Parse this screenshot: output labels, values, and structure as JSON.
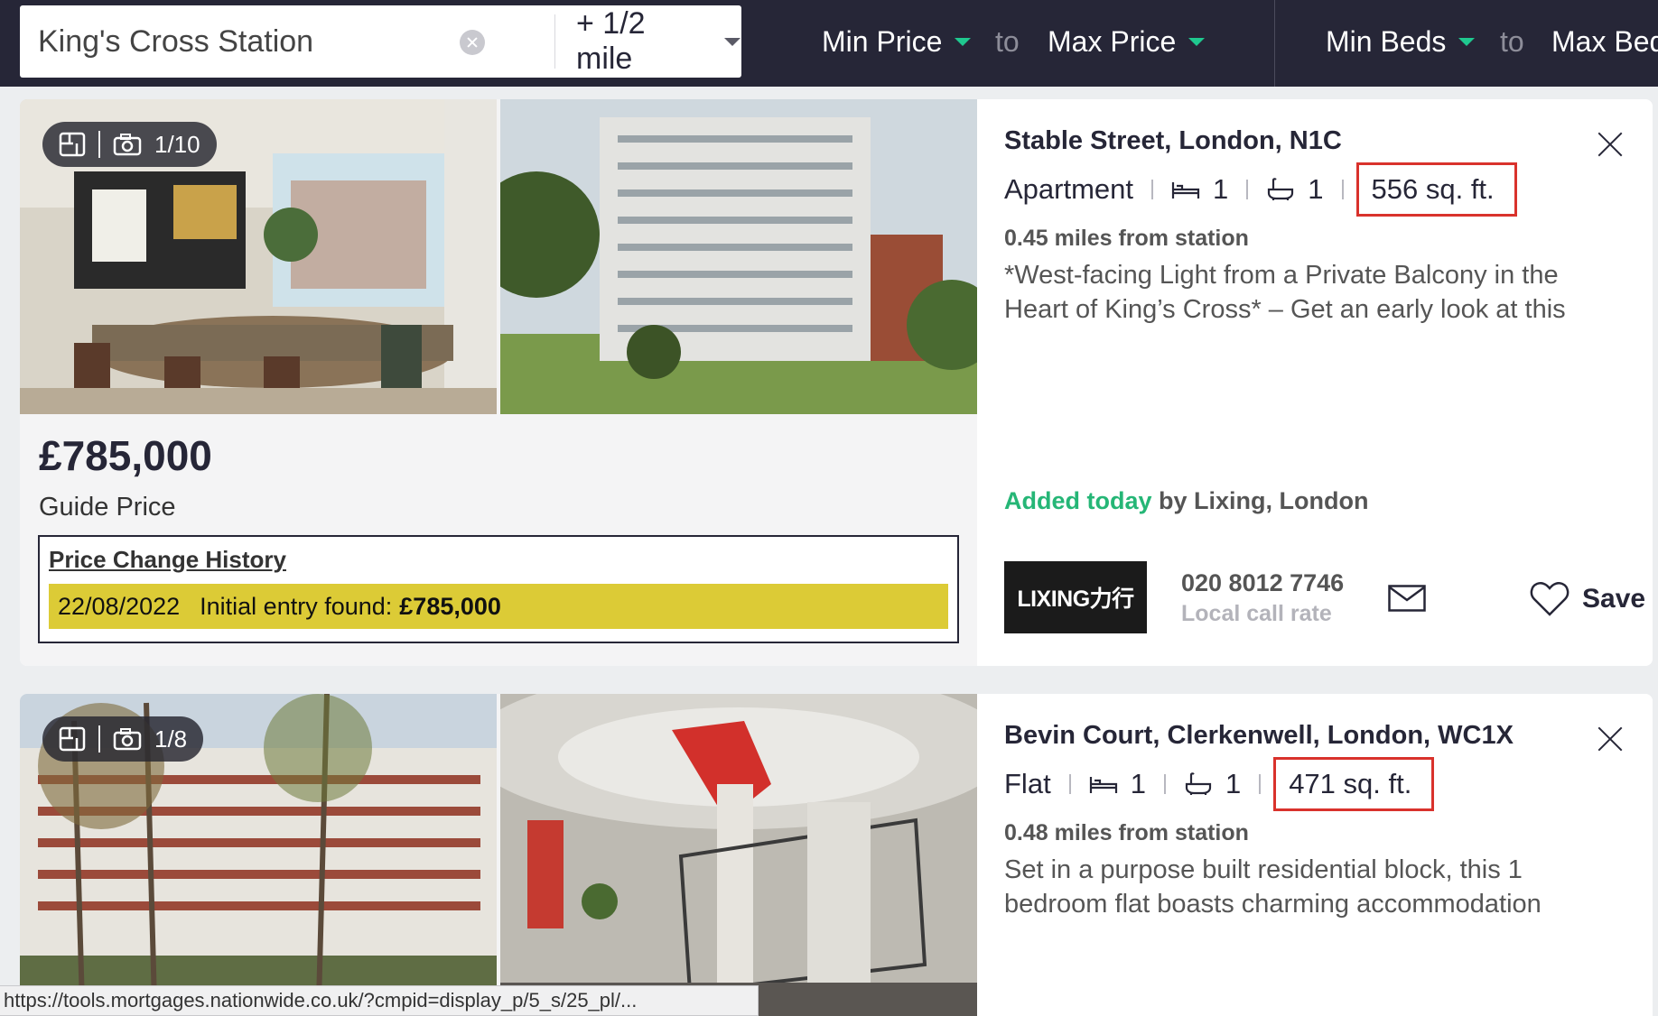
{
  "search": {
    "location_value": "King's Cross Station",
    "radius": "+ 1/2 mile"
  },
  "filters": {
    "min_price": "Min Price",
    "max_price": "Max Price",
    "min_beds": "Min Beds",
    "max_beds": "Max Beds",
    "to": "to"
  },
  "listings": [
    {
      "media_count": "1/10",
      "price": "£785,000",
      "price_qualifier": "Guide Price",
      "price_history_title": "Price Change History",
      "price_history": [
        {
          "date": "22/08/2022",
          "event": "Initial entry found:",
          "amount": "£785,000"
        }
      ],
      "address": "Stable Street, London, N1C",
      "property_type": "Apartment",
      "beds": "1",
      "baths": "1",
      "area": "556 sq. ft.",
      "distance": "0.45 miles from station",
      "summary": "*West-facing Light from a Private Balcony in the Heart of King’s Cross* – Get an early look at this",
      "added_label": "Added today",
      "agent": "by Lixing, London",
      "agent_logo_text": "LIXING力行",
      "phone": "020 8012 7746",
      "call_rate": "Local call rate",
      "save_label": "Save"
    },
    {
      "media_count": "1/8",
      "address": "Bevin Court, Clerkenwell, London, WC1X",
      "property_type": "Flat",
      "beds": "1",
      "baths": "1",
      "area": "471 sq. ft.",
      "distance": "0.48 miles from station",
      "summary": "Set in a purpose built residential block, this 1 bedroom flat boasts charming accommodation"
    }
  ],
  "status_bar_url": "https://tools.mortgages.nationwide.co.uk/?cmpid=display_p/5_s/25_pl/...",
  "colors": {
    "header_bg": "#262637",
    "accent_green": "#1fc88f",
    "highlight_yellow": "#dccb36",
    "annotation_red": "#d9322c"
  }
}
